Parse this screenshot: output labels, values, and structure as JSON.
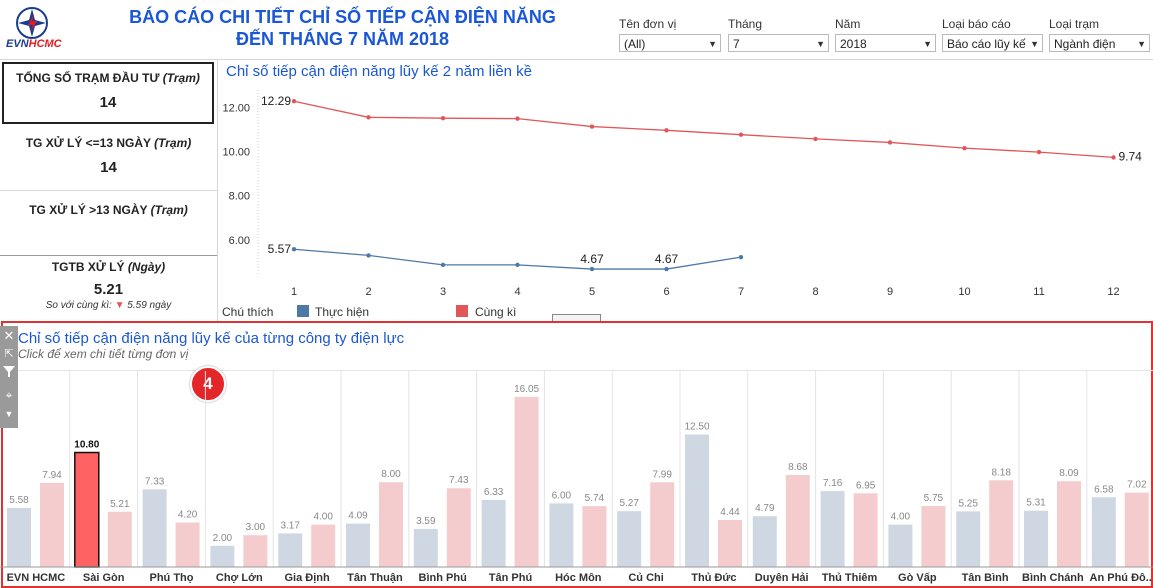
{
  "header": {
    "logo_text_a": "EVN",
    "logo_text_b": "HCMC",
    "title_line1": "BÁO CÁO CHI TIẾT CHỈ SỐ TIẾP CẬN ĐIỆN NĂNG",
    "title_line2": "ĐẾN THÁNG 7 NĂM 2018"
  },
  "filters": [
    {
      "label": "Tên đơn vị",
      "value": "(All)"
    },
    {
      "label": "Tháng",
      "value": "7"
    },
    {
      "label": "Năm",
      "value": "2018"
    },
    {
      "label": "Loại báo cáo",
      "value": "Báo cáo lũy kế"
    },
    {
      "label": "Loại trạm",
      "value": "Ngành điện"
    }
  ],
  "kpis": {
    "k1_label": "TỔNG SỐ TRẠM ĐẦU TƯ ",
    "k1_unit": "(Trạm)",
    "k1_value": "14",
    "k2_label": "TG XỬ LÝ <=13 NGÀY ",
    "k2_unit": "(Trạm)",
    "k2_value": "14",
    "k3_label": "TG XỬ LÝ >13 NGÀY ",
    "k3_unit": "(Trạm)",
    "k4_label": "TGTB XỬ LÝ ",
    "k4_unit": "(Ngày)",
    "k4_value": "5.21",
    "k4_compare_label": "So với cùng kì: ",
    "k4_compare_value": "5.59 ngày"
  },
  "line_panel": {
    "title": "Chỉ số tiếp cận điện năng lũy kế 2 năm liền kề",
    "legend_title": "Chú thích",
    "legend_actual": "Thực hiện",
    "legend_prev": "Cùng kì"
  },
  "bar_panel": {
    "title": "Chỉ số tiếp cận điện năng lũy kế của từng công ty điện lực",
    "subtitle": "Click để xem chi tiết từng đơn vị",
    "badge": "4"
  },
  "colors": {
    "actual": "#4e79a7",
    "previous": "#e15759",
    "bar_actual": "#cfd8e2",
    "bar_prev": "#f5cccd",
    "bar_selected": "#ff6262",
    "title_blue": "#1a57d6"
  },
  "chart_data": [
    {
      "type": "line",
      "title": "Chỉ số tiếp cận điện năng lũy kế 2 năm liền kề",
      "x": [
        1,
        2,
        3,
        4,
        5,
        6,
        7,
        8,
        9,
        10,
        11,
        12
      ],
      "ylim": [
        4.4,
        12.8
      ],
      "yticks": [
        "6.00",
        "8.00",
        "10.00",
        "12.00"
      ],
      "series": [
        {
          "name": "Cùng kì",
          "values": [
            12.29,
            11.56,
            11.52,
            11.5,
            11.14,
            10.97,
            10.77,
            10.58,
            10.42,
            10.16,
            9.98,
            9.74
          ],
          "labels": {
            "0": "12.29",
            "11": "9.74"
          }
        },
        {
          "name": "Thực hiện",
          "values": [
            5.57,
            5.29,
            4.86,
            4.86,
            4.67,
            4.67,
            5.21
          ],
          "labels": {
            "0": "5.57",
            "4": "4.67",
            "5": "4.67"
          }
        }
      ]
    },
    {
      "type": "bar",
      "title": "Chỉ số tiếp cận điện năng lũy kế của từng công ty điện lực",
      "categories": [
        "EVN HCMC",
        "Sài Gòn",
        "Phú Thọ",
        "Chợ Lớn",
        "Gia Định",
        "Tân Thuận",
        "Bình Phú",
        "Tân Phú",
        "Hóc Môn",
        "Củ Chi",
        "Thủ Đức",
        "Duyên Hải",
        "Thủ Thiêm",
        "Gò Vấp",
        "Tân Bình",
        "Bình Chánh",
        "An Phú Đô.."
      ],
      "ylim": [
        0,
        17
      ],
      "series": [
        {
          "name": "Thực hiện",
          "values": [
            5.58,
            10.8,
            7.33,
            2.0,
            3.17,
            4.09,
            3.59,
            6.33,
            6.0,
            5.27,
            12.5,
            4.79,
            7.16,
            4.0,
            5.25,
            5.31,
            6.58
          ],
          "labels": [
            "5.58",
            "10.80",
            "7.33",
            "2.00",
            "3.17",
            "4.09",
            "3.59",
            "6.33",
            "6.00",
            "5.27",
            "12.50",
            "4.79",
            "7.16",
            "4.00",
            "5.25",
            "5.31",
            "6.58"
          ]
        },
        {
          "name": "Cùng kì",
          "values": [
            7.94,
            5.21,
            4.2,
            3.0,
            4.0,
            8.0,
            7.43,
            16.05,
            5.74,
            7.99,
            4.44,
            8.68,
            6.95,
            5.75,
            8.18,
            8.09,
            7.02
          ],
          "labels": [
            "7.94",
            "5.21",
            "4.20",
            "3.00",
            "4.00",
            "8.00",
            "7.43",
            "16.05",
            "5.74",
            "7.99",
            "4.44",
            "8.68",
            "6.95",
            "5.75",
            "8.18",
            "8.09",
            "7.02"
          ]
        }
      ],
      "selected_index": 1
    }
  ]
}
